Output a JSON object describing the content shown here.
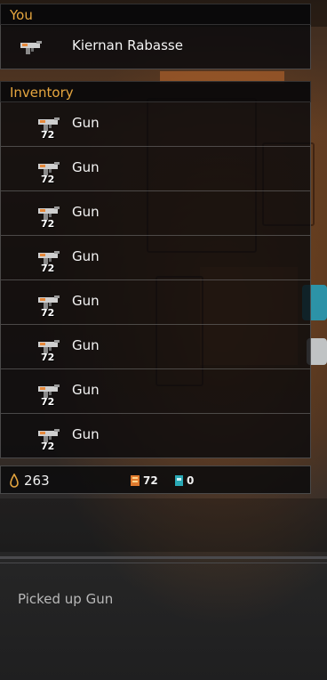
{
  "you": {
    "header": "You",
    "player_name": "Kiernan Rabasse",
    "equipped_icon": "gun-icon"
  },
  "inventory": {
    "header": "Inventory",
    "items": [
      {
        "name": "Gun",
        "quantity": "72",
        "icon": "gun-icon"
      },
      {
        "name": "Gun",
        "quantity": "72",
        "icon": "gun-icon"
      },
      {
        "name": "Gun",
        "quantity": "72",
        "icon": "gun-icon"
      },
      {
        "name": "Gun",
        "quantity": "72",
        "icon": "gun-icon"
      },
      {
        "name": "Gun",
        "quantity": "72",
        "icon": "gun-icon"
      },
      {
        "name": "Gun",
        "quantity": "72",
        "icon": "gun-icon"
      },
      {
        "name": "Gun",
        "quantity": "72",
        "icon": "gun-icon"
      },
      {
        "name": "Gun",
        "quantity": "72",
        "icon": "gun-icon"
      }
    ]
  },
  "status": {
    "currency": "263",
    "currency_icon": "drop-icon",
    "ammo": "72",
    "ammo_icon": "ammo-icon",
    "cards": "0",
    "cards_icon": "keycard-icon"
  },
  "message": "Picked up Gun",
  "colors": {
    "header_text": "#e6a63f",
    "panel_bg": "#0a0a0c",
    "text": "#f4f4f4",
    "message_text": "#b9b9b9"
  }
}
